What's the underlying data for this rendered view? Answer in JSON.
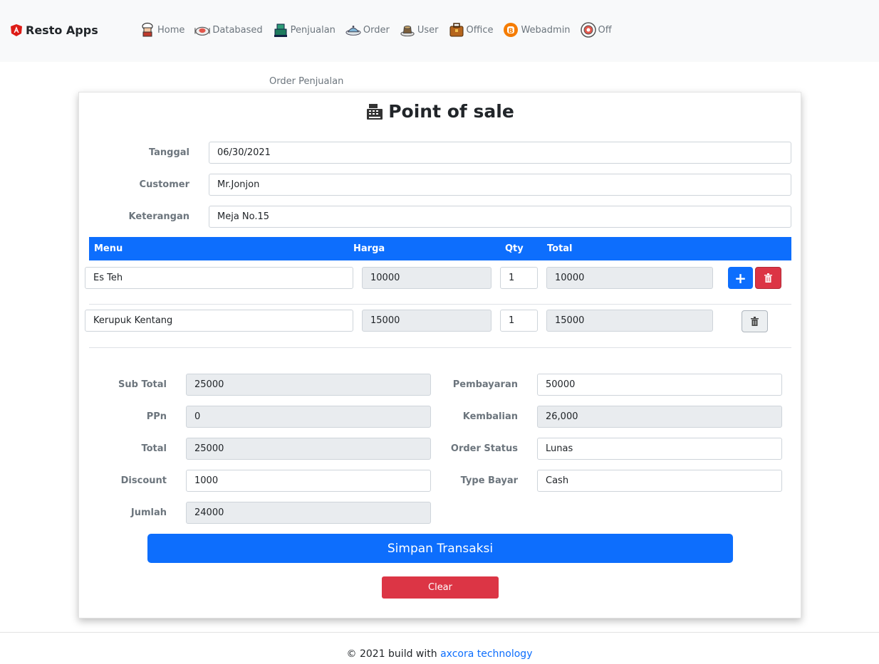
{
  "app": {
    "brand": "Resto Apps"
  },
  "nav": {
    "items": [
      {
        "label": "Home",
        "icon": "chef-icon"
      },
      {
        "label": "Databased",
        "icon": "database-icon"
      },
      {
        "label": "Penjualan",
        "icon": "register-icon"
      },
      {
        "label": "Order",
        "icon": "order-icon"
      },
      {
        "label": "User",
        "icon": "user-icon"
      },
      {
        "label": "Office",
        "icon": "office-icon"
      },
      {
        "label": "Webadmin",
        "icon": "webadmin-icon"
      },
      {
        "label": "Off",
        "icon": "power-icon"
      }
    ]
  },
  "breadcrumb": "Order Penjualan",
  "card": {
    "title": "Point of sale"
  },
  "form": {
    "tanggal_label": "Tanggal",
    "tanggal": "06/30/2021",
    "customer_label": "Customer",
    "customer": "Mr.Jonjon",
    "keterangan_label": "Keterangan",
    "keterangan": "Meja No.15"
  },
  "table": {
    "headers": [
      "Menu",
      "Harga",
      "Qty",
      "Total"
    ],
    "rows": [
      {
        "menu": "Es Teh",
        "harga": "10000",
        "qty": "1",
        "total": "10000"
      },
      {
        "menu": "Kerupuk Kentang",
        "harga": "15000",
        "qty": "1",
        "total": "15000"
      }
    ],
    "add_label": "+"
  },
  "summary": {
    "sub_total_label": "Sub Total",
    "sub_total": "25000",
    "ppn_label": "PPn",
    "ppn": "0",
    "total_label": "Total",
    "total": "25000",
    "discount_label": "Discount",
    "discount": "1000",
    "jumlah_label": "Jumlah",
    "jumlah": "24000",
    "pembayaran_label": "Pembayaran",
    "pembayaran": "50000",
    "kembalian_label": "Kembalian",
    "kembalian": "26,000",
    "order_status_label": "Order Status",
    "order_status": "Lunas",
    "type_bayar_label": "Type Bayar",
    "type_bayar": "Cash"
  },
  "actions": {
    "save": "Simpan Transaksi",
    "clear": "Clear"
  },
  "footer": {
    "text": "© 2021 build with",
    "link": "axcora technology"
  },
  "colors": {
    "primary": "#0d6efd",
    "danger": "#dc3545",
    "navbar_bg": "#f8f9fa"
  }
}
